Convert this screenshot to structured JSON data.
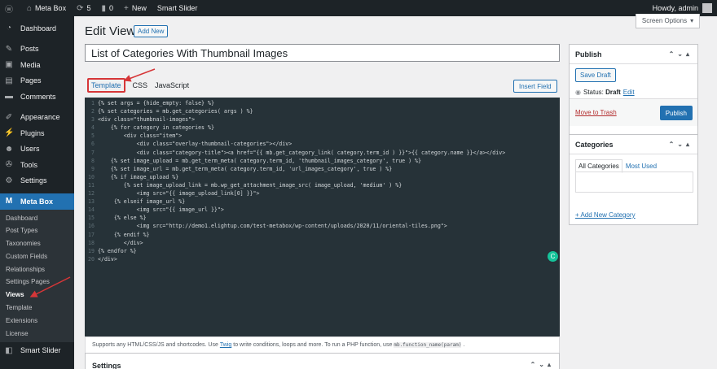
{
  "admin_bar": {
    "site_name": "Meta Box",
    "updates_count": "5",
    "comments_count": "0",
    "new_label": "New",
    "plugin_label": "Smart Slider",
    "howdy": "Howdy, admin"
  },
  "sidebar": {
    "items": [
      {
        "label": "Dashboard",
        "icon": "dashboard-icon"
      },
      {
        "label": "Posts",
        "icon": "pin-icon"
      },
      {
        "label": "Media",
        "icon": "media-icon"
      },
      {
        "label": "Pages",
        "icon": "page-icon"
      },
      {
        "label": "Comments",
        "icon": "comment-icon"
      },
      {
        "label": "Appearance",
        "icon": "brush-icon"
      },
      {
        "label": "Plugins",
        "icon": "plugin-icon"
      },
      {
        "label": "Users",
        "icon": "user-icon"
      },
      {
        "label": "Tools",
        "icon": "wrench-icon"
      },
      {
        "label": "Settings",
        "icon": "settings-icon"
      },
      {
        "label": "Meta Box",
        "icon": "metabox-icon"
      }
    ],
    "submenu": [
      "Dashboard",
      "Post Types",
      "Taxonomies",
      "Custom Fields",
      "Relationships",
      "Settings Pages",
      "Views",
      "Template",
      "Extensions",
      "License"
    ],
    "smart_slider": "Smart Slider"
  },
  "screen_options": "Screen Options",
  "page": {
    "title": "Edit View",
    "add_new": "Add New",
    "view_title": "List of Categories With Thumbnail Images"
  },
  "tabs": {
    "template": "Template",
    "css": "CSS",
    "javascript": "JavaScript",
    "insert_field": "Insert Field"
  },
  "code_lines": [
    "{% set args = {hide_empty: false} %}",
    "{% set categories = mb.get_categories( args ) %}",
    "<div class=\"thumbnail-images\">",
    "    {% for category in categories %}",
    "        <div class=\"item\">",
    "            <div class=\"overlay-thumbnail-categories\"></div>",
    "            <div class=\"category-title\"><a href=\"{{ mb.get_category_link( category.term_id ) }}\">{{ category.name }}</a></div>",
    "    {% set image_upload = mb.get_term_meta( category.term_id, 'thumbnail_images_category', true ) %}",
    "    {% set image_url = mb.get_term_meta( category.term_id, 'url_images_category', true ) %}",
    "    {% if image_upload %}",
    "        {% set image_upload_link = mb.wp_get_attachment_image_src( image_upload, 'medium' ) %}",
    "            <img src=\"{{ image_upload_link[0] }}\">",
    "     {% elseif image_url %}",
    "            <img src=\"{{ image_url }}\">",
    "     {% else %}",
    "            <img src=\"http://demo1.elightup.com/test-metabox/wp-content/uploads/2020/11/oriental-tiles.png\">",
    "     {% endif %}",
    "        </div>",
    "{% endfor %}",
    "</div>"
  ],
  "footer_note": {
    "prefix": "Supports any HTML/CSS/JS and shortcodes. Use",
    "link": "Twig",
    "middle": "to write conditions, loops and more. To run a PHP function, use",
    "code": "mb.function_name(param)",
    "suffix": "."
  },
  "settings_box": "Settings",
  "publish": {
    "title": "Publish",
    "save_draft": "Save Draft",
    "status_label": "Status:",
    "status_value": "Draft",
    "edit": "Edit",
    "move_to_trash": "Move to Trash",
    "publish_button": "Publish"
  },
  "categories": {
    "title": "Categories",
    "tab_all": "All Categories",
    "tab_most_used": "Most Used",
    "add_new": "+ Add New Category"
  },
  "colors": {
    "admin_dark": "#1d2327",
    "wp_blue": "#2271b1",
    "highlight_red": "#d63638",
    "editor_bg": "#263238"
  }
}
